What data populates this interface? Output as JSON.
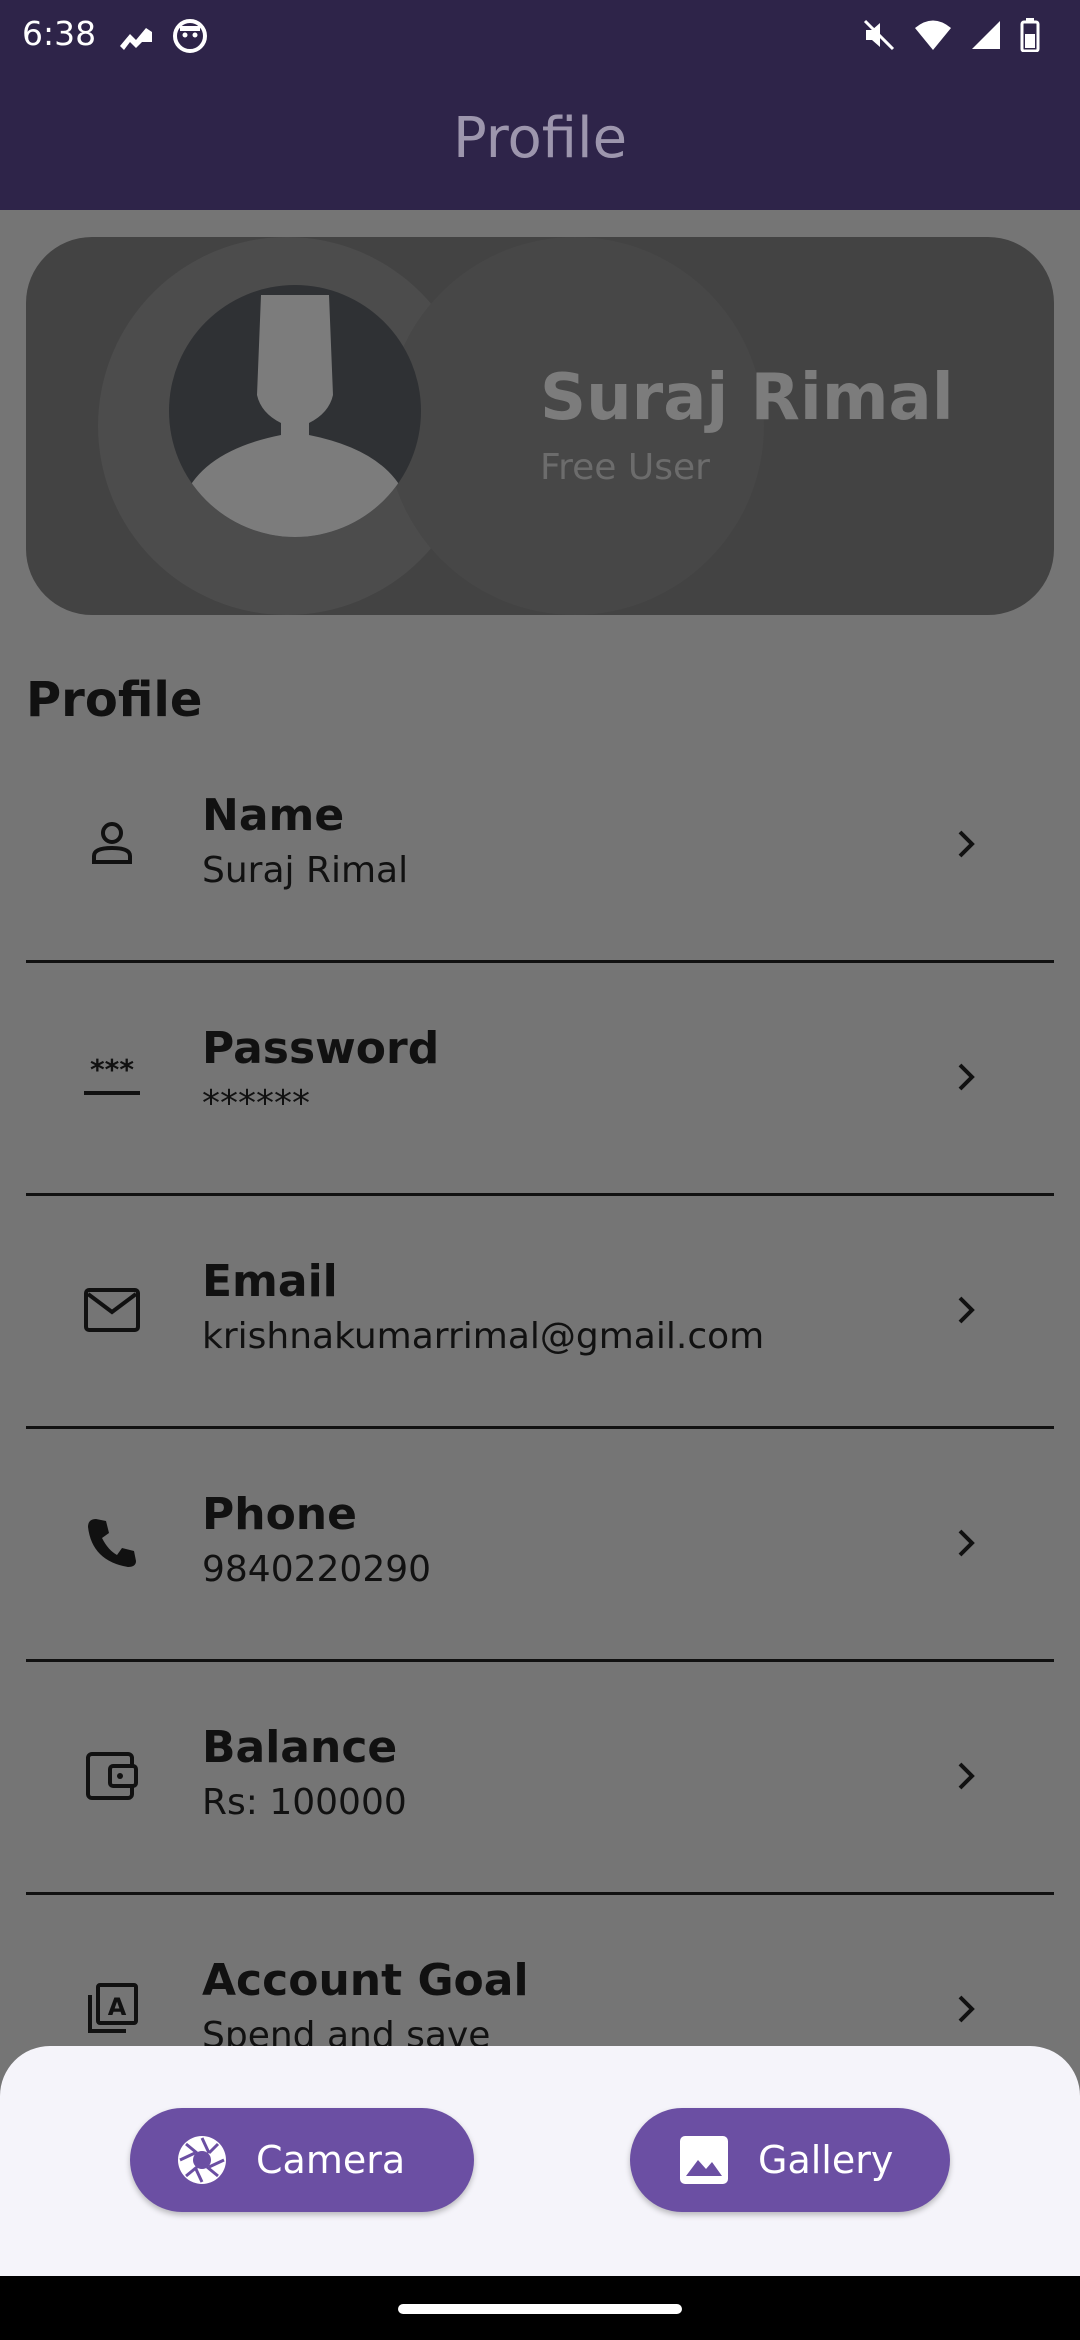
{
  "status_bar": {
    "time": "6:38",
    "left_icons": [
      "trend-icon",
      "cat-face-icon"
    ],
    "right_icons": [
      "mute-icon",
      "wifi-icon",
      "signal-icon",
      "battery-icon"
    ]
  },
  "app_bar": {
    "title": "Profile"
  },
  "profile_card": {
    "name": "Suraj Rimal",
    "tier": "Free User"
  },
  "section": {
    "title": "Profile"
  },
  "items": [
    {
      "label": "Name",
      "value": "Suraj Rimal",
      "icon": "person-icon"
    },
    {
      "label": "Password",
      "value": "******",
      "icon": "password-icon"
    },
    {
      "label": "Email",
      "value": "krishnakumarrimal@gmail.com",
      "icon": "mail-icon"
    },
    {
      "label": "Phone",
      "value": "9840220290",
      "icon": "phone-icon"
    },
    {
      "label": "Balance",
      "value": "Rs: 100000",
      "icon": "wallet-icon"
    },
    {
      "label": "Account Goal",
      "value": "Spend and save",
      "icon": "assignment-icon"
    }
  ],
  "bottom_sheet": {
    "camera_label": "Camera",
    "gallery_label": "Gallery"
  },
  "colors": {
    "app_bar": "#2e2449",
    "overlay_background": "#757575",
    "button": "#6b4fa3",
    "sheet": "#f5f4fa"
  }
}
